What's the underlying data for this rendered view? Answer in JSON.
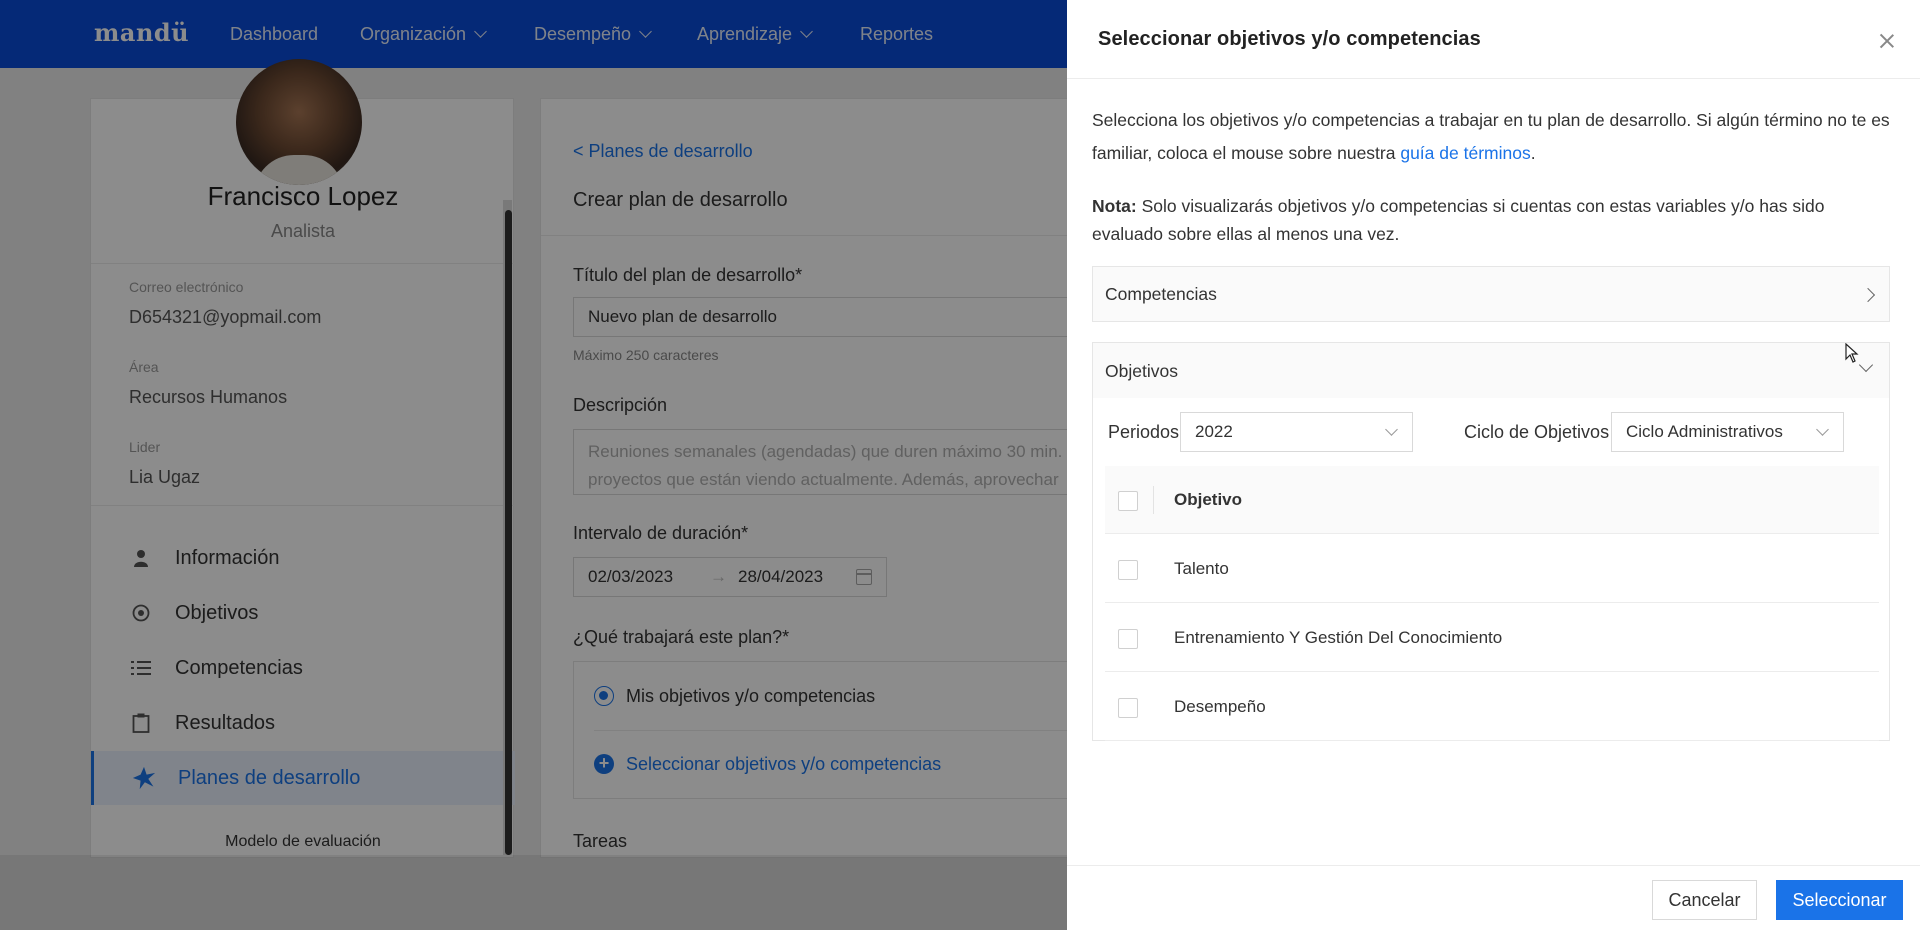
{
  "nav": {
    "logo": "mandü",
    "items": [
      {
        "label": "Dashboard",
        "has_dropdown": false
      },
      {
        "label": "Organización",
        "has_dropdown": true
      },
      {
        "label": "Desempeño",
        "has_dropdown": true
      },
      {
        "label": "Aprendizaje",
        "has_dropdown": true
      },
      {
        "label": "Reportes",
        "has_dropdown": false
      }
    ]
  },
  "profile": {
    "name": "Francisco Lopez",
    "role": "Analista",
    "email_label": "Correo electrónico",
    "email": "D654321@yopmail.com",
    "area_label": "Área",
    "area": "Recursos Humanos",
    "leader_label": "Lider",
    "leader": "Lia Ugaz",
    "menu": [
      {
        "label": "Información",
        "icon": "user-icon",
        "active": false
      },
      {
        "label": "Objetivos",
        "icon": "target-icon",
        "active": false
      },
      {
        "label": "Competencias",
        "icon": "list-icon",
        "active": false
      },
      {
        "label": "Resultados",
        "icon": "clipboard-icon",
        "active": false
      },
      {
        "label": "Planes de desarrollo",
        "icon": "star-burst-icon",
        "active": true
      }
    ],
    "footer": "Modelo de evaluación"
  },
  "plan": {
    "back_link": "< Planes de desarrollo",
    "title": "Crear plan de desarrollo",
    "title_label": "Título del plan de desarrollo*",
    "title_value": "Nuevo plan de desarrollo",
    "title_hint": "Máximo 250 caracteres",
    "description_label": "Descripción",
    "description_line1": "Reuniones semanales (agendadas) que duren máximo 30 min. ",
    "description_line2": "proyectos que están viendo actualmente. Además, aprovechar",
    "interval_label": "Intervalo de duración*",
    "date_start": "02/03/2023",
    "date_arrow": "→",
    "date_end": "28/04/2023",
    "work_label": "¿Qué trabajará este plan?*",
    "radio_label": "Mis objetivos y/o competencias",
    "select_link": "Seleccionar objetivos y/o competencias",
    "tasks_label": "Tareas"
  },
  "drawer": {
    "title": "Seleccionar objetivos y/o competencias",
    "intro_text": "Selecciona los objetivos y/o competencias a trabajar en tu plan de desarrollo. Si algún término no te es familiar, coloca el mouse sobre nuestra ",
    "intro_link": "guía de términos",
    "intro_end": ".",
    "note_label": "Nota:",
    "note_text": " Solo visualizarás objetivos y/o competencias si cuentas con estas variables y/o has sido evaluado sobre ellas al menos una vez.",
    "competencias_title": "Competencias",
    "objetivos_title": "Objetivos",
    "periodos_label": "Periodos",
    "periodos_value": "2022",
    "ciclo_label": "Ciclo de Objetivos",
    "ciclo_value": "Ciclo Administrativos",
    "table_header": "Objetivo",
    "rows": [
      "Talento",
      "Entrenamiento Y Gestión Del Conocimiento",
      "Desempeño"
    ],
    "cancel_label": "Cancelar",
    "select_label": "Seleccionar"
  },
  "colors": {
    "nav_bg": "#0a4bd9",
    "primary": "#1a73e8"
  }
}
